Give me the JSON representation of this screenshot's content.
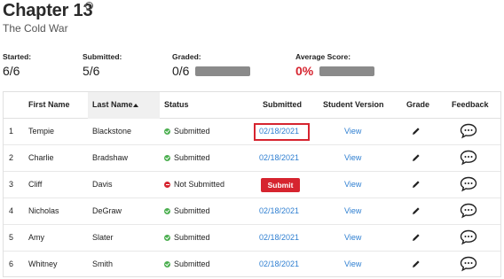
{
  "header": {
    "title": "Chapter 13",
    "info_icon": "info-icon",
    "subtitle": "The Cold War"
  },
  "stats": {
    "started_label": "Started:",
    "started_value": "6/6",
    "submitted_label": "Submitted:",
    "submitted_value": "5/6",
    "graded_label": "Graded:",
    "graded_value": "0/6",
    "average_label": "Average Score:",
    "average_value": "0%"
  },
  "colors": {
    "accent_red": "#d6242f",
    "link_blue": "#2f7fd1",
    "success_green": "#4caf50",
    "bar_grey": "#8a8a8a"
  },
  "table": {
    "columns": {
      "index": "",
      "first_name": "First Name",
      "last_name": "Last Name",
      "status": "Status",
      "submitted": "Submitted",
      "student_version": "Student Version",
      "grade": "Grade",
      "feedback": "Feedback"
    },
    "sorted_column": "last_name",
    "sort_direction": "ascending",
    "rows": [
      {
        "index": "1",
        "first": "Tempie",
        "last": "Blackstone",
        "status": "Submitted",
        "submitted": "02/18/2021",
        "version": "View"
      },
      {
        "index": "2",
        "first": "Charlie",
        "last": "Bradshaw",
        "status": "Submitted",
        "submitted": "02/18/2021",
        "version": "View"
      },
      {
        "index": "3",
        "first": "Cliff",
        "last": "Davis",
        "status": "Not Submitted",
        "submitted": "Submit",
        "version": "View"
      },
      {
        "index": "4",
        "first": "Nicholas",
        "last": "DeGraw",
        "status": "Submitted",
        "submitted": "02/18/2021",
        "version": "View"
      },
      {
        "index": "5",
        "first": "Amy",
        "last": "Slater",
        "status": "Submitted",
        "submitted": "02/18/2021",
        "version": "View"
      },
      {
        "index": "6",
        "first": "Whitney",
        "last": "Smith",
        "status": "Submitted",
        "submitted": "02/18/2021",
        "version": "View"
      }
    ]
  }
}
